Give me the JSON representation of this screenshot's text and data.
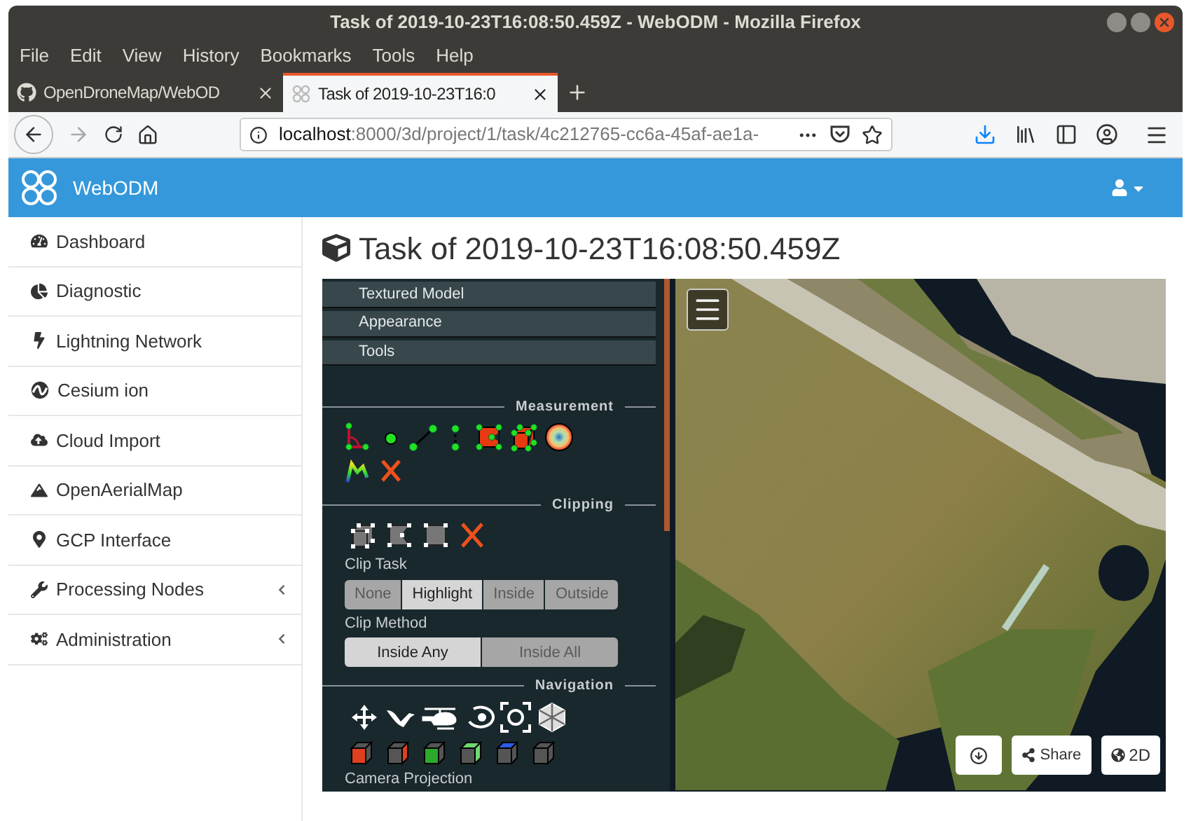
{
  "window": {
    "title": "Task of 2019-10-23T16:08:50.459Z - WebODM - Mozilla Firefox"
  },
  "menu": [
    "File",
    "Edit",
    "View",
    "History",
    "Bookmarks",
    "Tools",
    "Help"
  ],
  "tabs": [
    {
      "label": "OpenDroneMap/WebOD",
      "selected": false
    },
    {
      "label": "Task of 2019-10-23T16:0",
      "selected": true
    }
  ],
  "address": {
    "host": "localhost",
    "path": ":8000/3d/project/1/task/4c212765-cc6a-45af-ae1a-"
  },
  "app": {
    "brand": "WebODM"
  },
  "sidebar": {
    "items": [
      {
        "label": "Dashboard",
        "submenu": false
      },
      {
        "label": "Diagnostic",
        "submenu": false
      },
      {
        "label": "Lightning Network",
        "submenu": false
      },
      {
        "label": "Cesium ion",
        "submenu": false
      },
      {
        "label": "Cloud Import",
        "submenu": false
      },
      {
        "label": "OpenAerialMap",
        "submenu": false
      },
      {
        "label": "GCP Interface",
        "submenu": false
      },
      {
        "label": "Processing Nodes",
        "submenu": true
      },
      {
        "label": "Administration",
        "submenu": true
      }
    ]
  },
  "page_title": "Task of 2019-10-23T16:08:50.459Z",
  "viewer": {
    "sections": [
      "Textured Model",
      "Appearance",
      "Tools"
    ],
    "measurement_heading": "Measurement",
    "clipping_heading": "Clipping",
    "clip_task": {
      "label": "Clip Task",
      "options": [
        {
          "label": "None",
          "selected": false
        },
        {
          "label": "Highlight",
          "selected": true
        },
        {
          "label": "Inside",
          "selected": false
        },
        {
          "label": "Outside",
          "selected": false
        }
      ]
    },
    "clip_method": {
      "label": "Clip Method",
      "options": [
        {
          "label": "Inside Any",
          "selected": true
        },
        {
          "label": "Inside All",
          "selected": false
        }
      ]
    },
    "navigation_heading": "Navigation",
    "camera_projection": "Camera Projection",
    "buttons": [
      "Share",
      "2D"
    ]
  }
}
